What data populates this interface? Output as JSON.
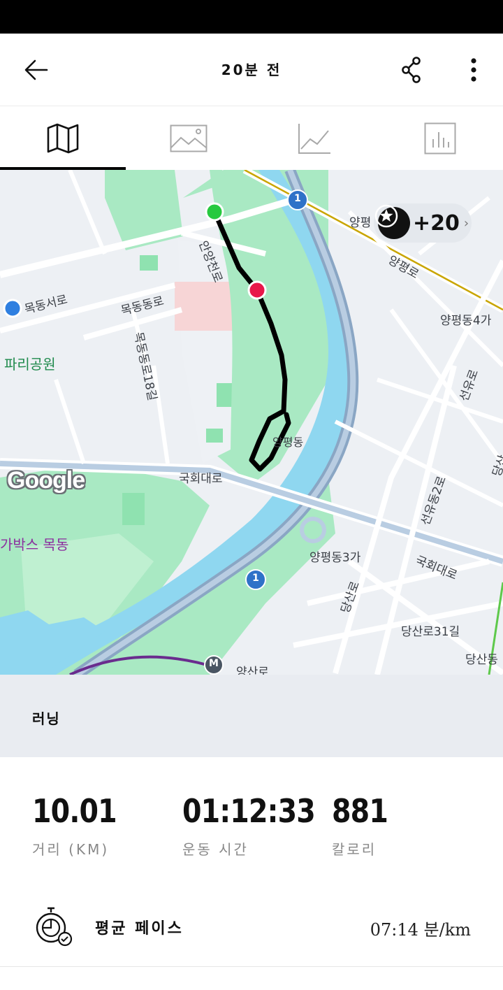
{
  "header": {
    "title": "20분 전"
  },
  "tabs": [
    {
      "name": "map",
      "icon": "map-icon",
      "active": true
    },
    {
      "name": "photo",
      "icon": "image-icon",
      "active": false
    },
    {
      "name": "graph",
      "icon": "line-chart-icon",
      "active": false
    },
    {
      "name": "splits",
      "icon": "bar-chart-icon",
      "active": false
    }
  ],
  "map": {
    "badge": "+20",
    "labels": {
      "mokdongseoro": "목동서로",
      "mokdongdongro": "목동동로",
      "mokdongdongro18": "목동동로18길",
      "yangcheonro": "안양천로",
      "paris_park": "파리공원",
      "yangpyeong_top": "양평",
      "yangpyeongro": "양평로",
      "yangpyeong4ga": "양평동4가",
      "seonyuro": "선유로",
      "yangpyeongdong": "양평동",
      "gukhoedaero_left": "국회대로",
      "gukhoedaero_right": "국회대로",
      "seonyudong2ro": "선유동2로",
      "yangpyeong3ga": "양평동3가",
      "dangsanro": "당산로",
      "dangsanro31": "당산로31길",
      "dangsandong": "당산동",
      "dang": "당산",
      "megabox": "가박스 목동",
      "yangsanro": "양산로",
      "route1": "1",
      "metro": "M",
      "logo": "Google"
    },
    "colors": {
      "route": "#000000",
      "start": "#27c93f",
      "end": "#e8174a",
      "river": "#8fd7f0",
      "park": "#a9e9c3"
    }
  },
  "activity": {
    "type": "러닝"
  },
  "stats": [
    {
      "value": "10.01",
      "label": "거리 (KM)"
    },
    {
      "value": "01:12:33",
      "label": "운동 시간"
    },
    {
      "value": "881",
      "label": "칼로리"
    }
  ],
  "pace": {
    "label": "평균 페이스",
    "value": "07:14 분/km"
  }
}
